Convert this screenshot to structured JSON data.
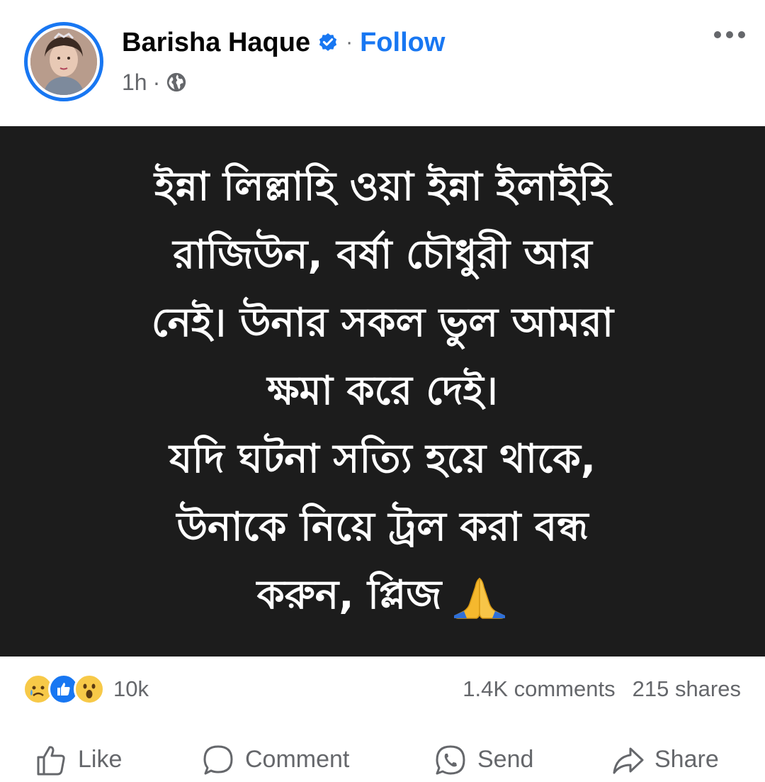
{
  "post": {
    "author": "Barisha Haque",
    "separator": "·",
    "follow_label": "Follow",
    "time": "1h",
    "meta_separator": "·",
    "privacy_icon": "globe-icon",
    "more_icon": "more-options-icon"
  },
  "image_text": {
    "lines": [
      "ইন্না লিল্লাহি ওয়া ইন্না ইলাইহি",
      "রাজিউন, বর্ষা চৌধুরী আর",
      "নেই। উনার সকল ভুল আমরা",
      "ক্ষমা করে দেই।",
      "যদি ঘটনা সত্যি হয়ে থাকে,",
      "উনাকে নিয়ে ট্রল করা বন্ধ",
      "করুন, প্লিজ"
    ],
    "emoji": "folded-hands"
  },
  "stats": {
    "reactions": [
      "sad",
      "like",
      "wow"
    ],
    "reaction_count": "10k",
    "comments": "1.4K comments",
    "shares": "215 shares"
  },
  "actions": {
    "like": "Like",
    "comment": "Comment",
    "send": "Send",
    "share": "Share"
  },
  "colors": {
    "accent": "#1877f2",
    "secondary_text": "#65676b",
    "image_bg": "#1c1c1c"
  }
}
